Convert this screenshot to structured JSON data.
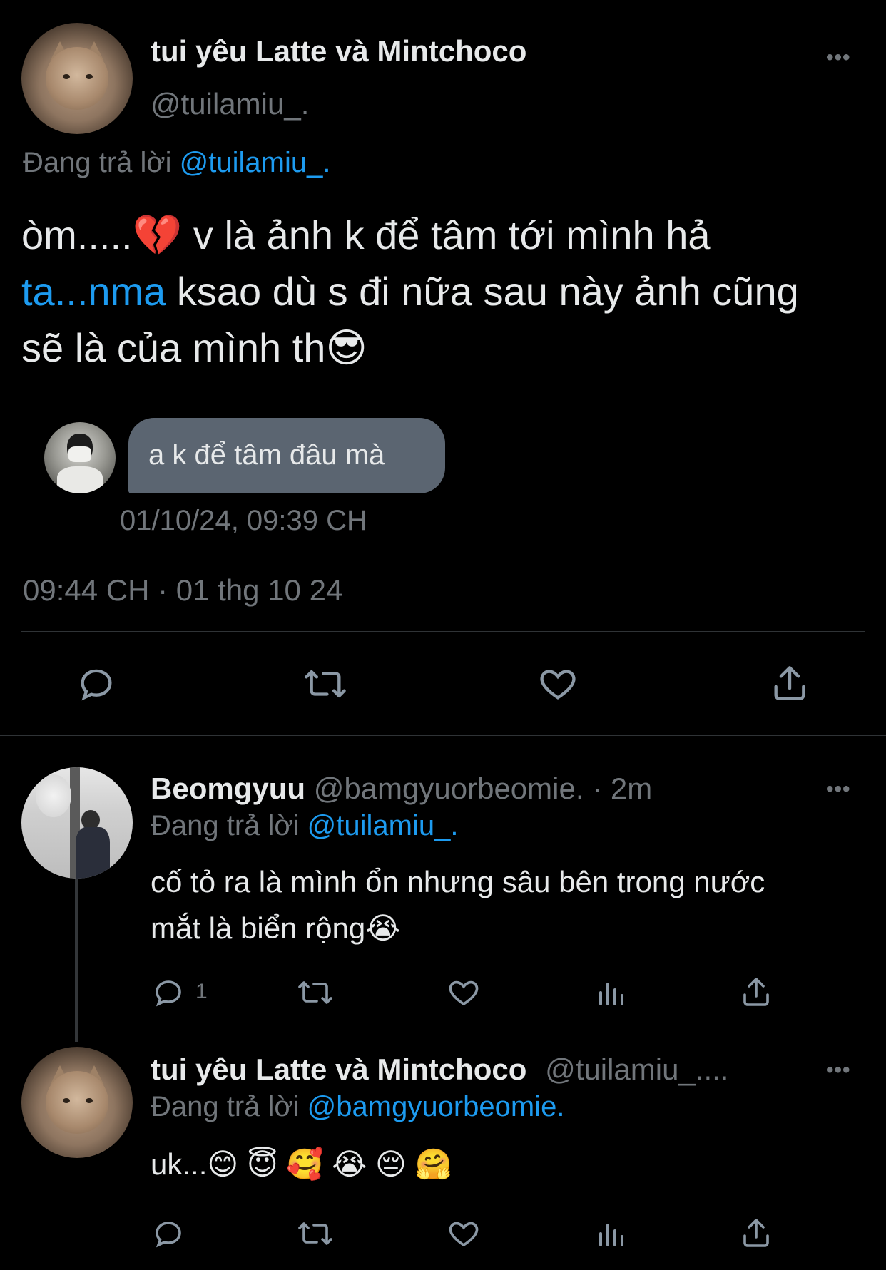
{
  "main_tweet": {
    "display_name": "tui yêu Latte và Mintchoco",
    "handle": "@tuilamiu_.",
    "replying_prefix": "Đang trả lời",
    "replying_to": "@tuilamiu_.",
    "text_line1": "òm.....",
    "text_line1_rest": " v là ảnh k để tâm tới mình hả",
    "text_line2_link": "ta...nma",
    "text_line2_rest": " ksao dù s đi nữa sau này ảnh cũng",
    "text_line3": "sẽ là của mình th",
    "quoted_message": "a k để tâm đâu mà",
    "quoted_timestamp": "01/10/24, 09:39 CH",
    "timestamp": "09:44 CH · 01 thg 10 24"
  },
  "reply1": {
    "display_name": "Beomgyuu",
    "handle": "@bamgyuorbeomie.",
    "time": "· 2m",
    "replying_prefix": "Đang trả lời",
    "replying_to": "@tuilamiu_.",
    "text_line1": "cố tỏ ra là mình ổn nhưng sâu bên trong nước",
    "text_line2": "mắt là biển rộng",
    "reply_count": "1"
  },
  "reply2": {
    "display_name": "tui yêu Latte và Mintchoco",
    "handle": "@tuilamiu_....",
    "replying_prefix": "Đang trả lời",
    "replying_to": "@bamgyuorbeomie.",
    "text": "uk..."
  },
  "icons": {
    "reply": "reply-icon",
    "retweet": "retweet-icon",
    "like": "heart-icon",
    "share": "share-icon",
    "views": "views-icon",
    "more": "more-icon"
  },
  "colors": {
    "link": "#1d9bf0",
    "muted": "#71767b",
    "bg": "#000000"
  }
}
